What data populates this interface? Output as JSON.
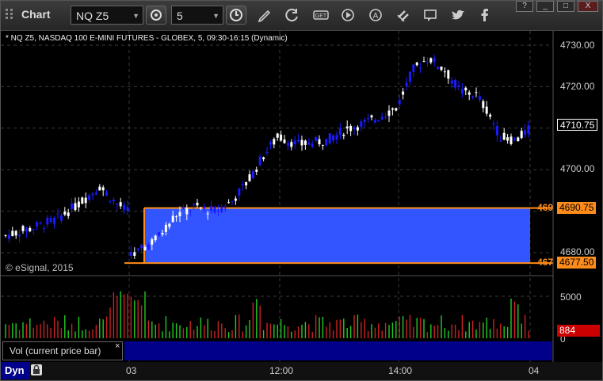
{
  "toolbar": {
    "title": "Chart",
    "symbol": "NQ Z5",
    "interval": "5",
    "icons": [
      "clock-icon",
      "pencil-icon",
      "refresh-icon",
      "get-icon",
      "play-icon",
      "alert-icon",
      "link-icon",
      "comment-icon",
      "twitter-icon",
      "facebook-icon"
    ]
  },
  "window_controls": [
    "?",
    "_",
    "□",
    "X"
  ],
  "chart": {
    "header": "* NQ Z5, NASDAQ 100 E-MINI FUTURES - GLOBEX, 5, 09:30-16:15 (Dynamic)",
    "watermark": "© eSignal, 2015",
    "price_axis": [
      "4730.00",
      "4720.00",
      "4710.00",
      "4700.00",
      "4680.00"
    ],
    "last_price": "4710.75",
    "range_high_short": "469",
    "range_high": "4690.75",
    "range_low_short": "467",
    "range_low": "4677.50",
    "volume_axis": [
      "5000",
      "0"
    ],
    "volume_value": "884",
    "volume_label": "Vol (current price bar)",
    "time_axis": [
      "03",
      "12:00",
      "14:00",
      "04"
    ],
    "dyn_label": "Dyn",
    "colors": {
      "up": "#ffffff",
      "down": "#1a1aff",
      "range_fill": "#3355ff",
      "range_line": "#ff8c1a",
      "vol_up": "#22cc22",
      "vol_down": "#cc2222"
    }
  }
}
